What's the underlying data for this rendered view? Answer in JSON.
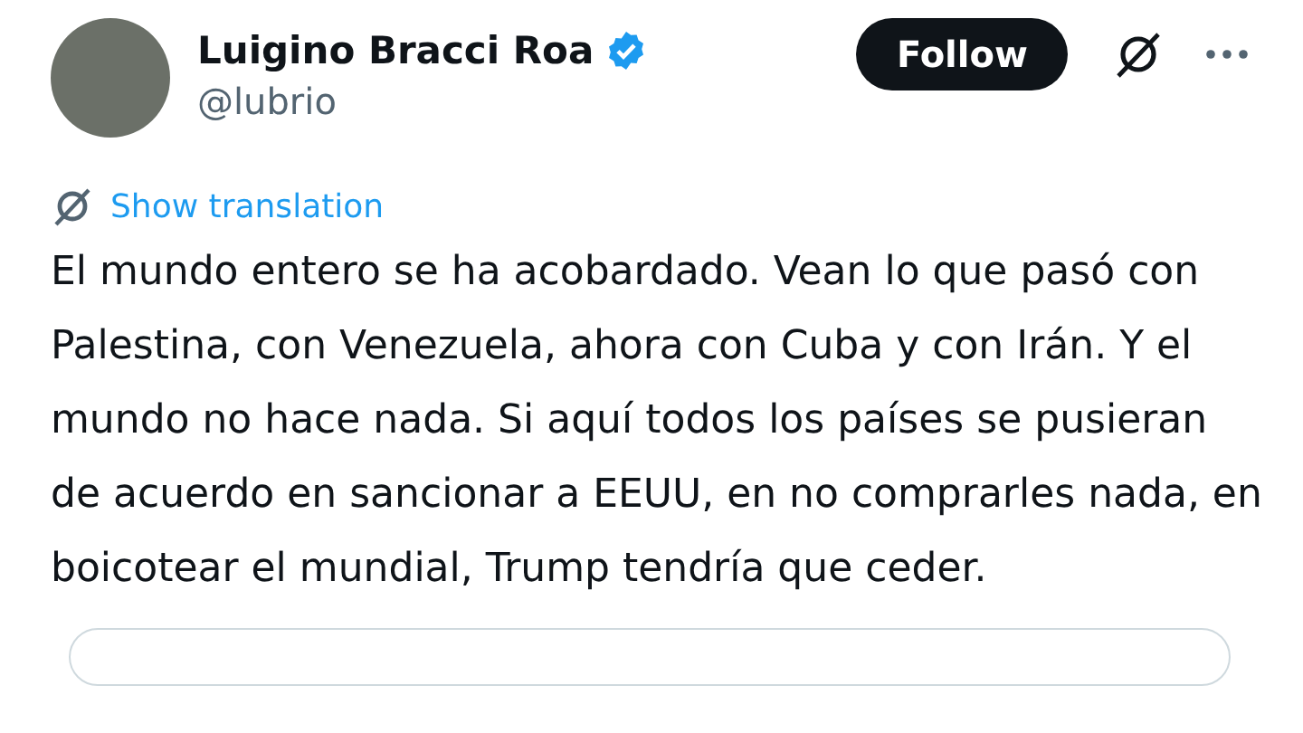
{
  "author": {
    "name": "Luigino Bracci Roa",
    "verified": true,
    "handle": "@lubrio"
  },
  "actions": {
    "follow": "Follow"
  },
  "translation_link": "Show translation",
  "text": "El mundo entero se ha acobardado. Vean lo que pasó con Palestina, con Venezuela, ahora con Cuba y con Irán. Y el mundo no hace nada. Si aquí todos los países se pusieran de acuerdo en sancionar a EEUU, en no comprarles nada, en boicotear el mundial, Trump tendría que ceder."
}
